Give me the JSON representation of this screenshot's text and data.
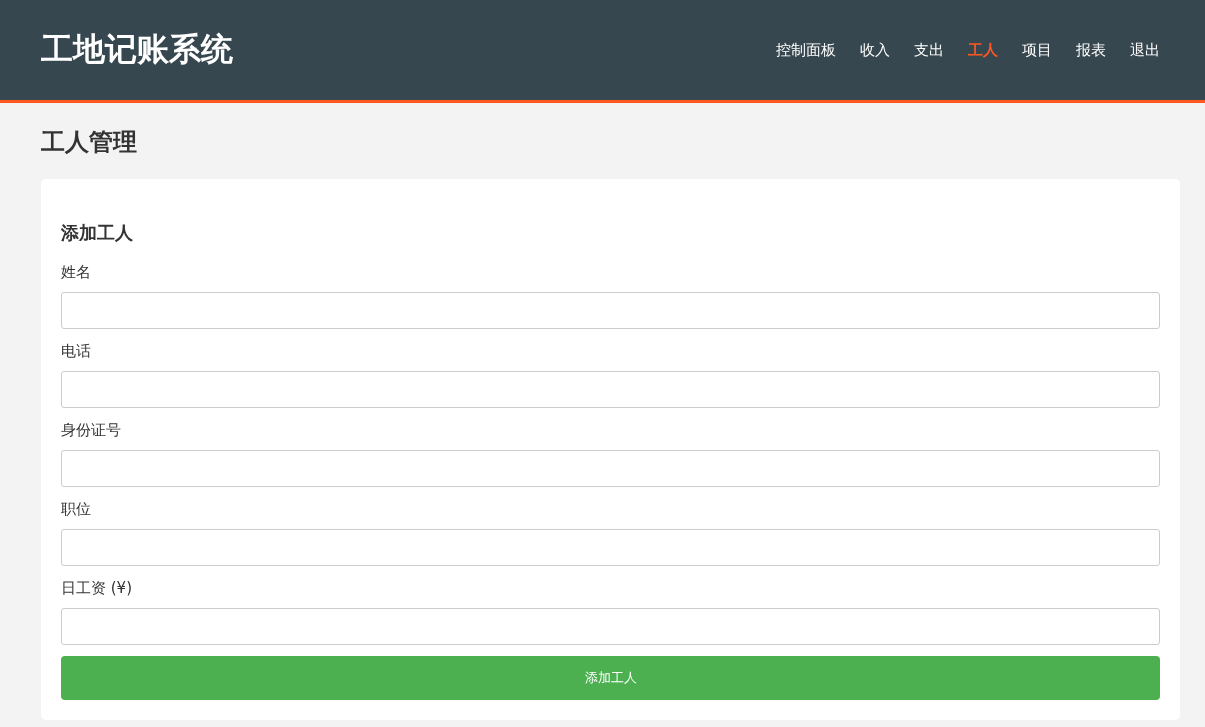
{
  "header": {
    "title": "工地记账系统",
    "nav": [
      {
        "label": "控制面板",
        "selected": false
      },
      {
        "label": "收入",
        "selected": false
      },
      {
        "label": "支出",
        "selected": false
      },
      {
        "label": "工人",
        "selected": true
      },
      {
        "label": "项目",
        "selected": false
      },
      {
        "label": "报表",
        "selected": false
      },
      {
        "label": "退出",
        "selected": false
      }
    ]
  },
  "page_title": "工人管理",
  "form": {
    "title": "添加工人",
    "fields": [
      {
        "label": "姓名"
      },
      {
        "label": "电话"
      },
      {
        "label": "身份证号"
      },
      {
        "label": "职位"
      },
      {
        "label": "日工资 (¥)"
      }
    ],
    "submit": "添加工人"
  }
}
